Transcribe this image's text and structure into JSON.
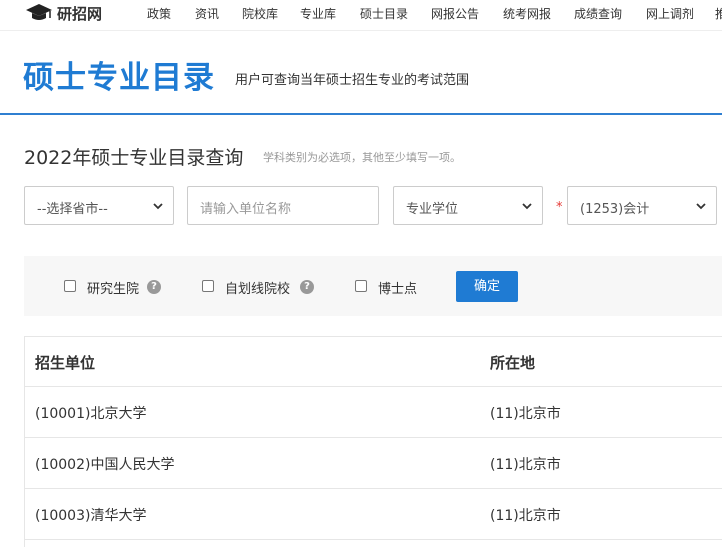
{
  "nav": {
    "logo_text": "研招网",
    "items": [
      "政策",
      "资讯",
      "院校库",
      "专业库",
      "硕士目录",
      "网报公告",
      "统考网报",
      "成绩查询",
      "网上调剂",
      "推"
    ]
  },
  "header": {
    "title": "硕士专业目录",
    "subtitle": "用户可查询当年硕士招生专业的考试范围"
  },
  "query": {
    "title": "2022年硕士专业目录查询",
    "note": "学科类别为必选项，其他至少填写一项。",
    "province_select": "--选择省市--",
    "unit_placeholder": "请输入单位名称",
    "degree_select": "专业学位",
    "required_mark": "*",
    "major_select": "(1253)会计"
  },
  "filters": {
    "graduate_school_label": "研究生院",
    "self_line_label": "自划线院校",
    "phd_label": "博士点",
    "help_glyph": "?",
    "confirm_label": "确定"
  },
  "table": {
    "headers": [
      "招生单位",
      "所在地"
    ],
    "rows": [
      [
        "(10001)北京大学",
        "(11)北京市"
      ],
      [
        "(10002)中国人民大学",
        "(11)北京市"
      ],
      [
        "(10003)清华大学",
        "(11)北京市"
      ]
    ]
  },
  "colors": {
    "brand_blue": "#1f7bd3",
    "required_red": "#e53935"
  }
}
